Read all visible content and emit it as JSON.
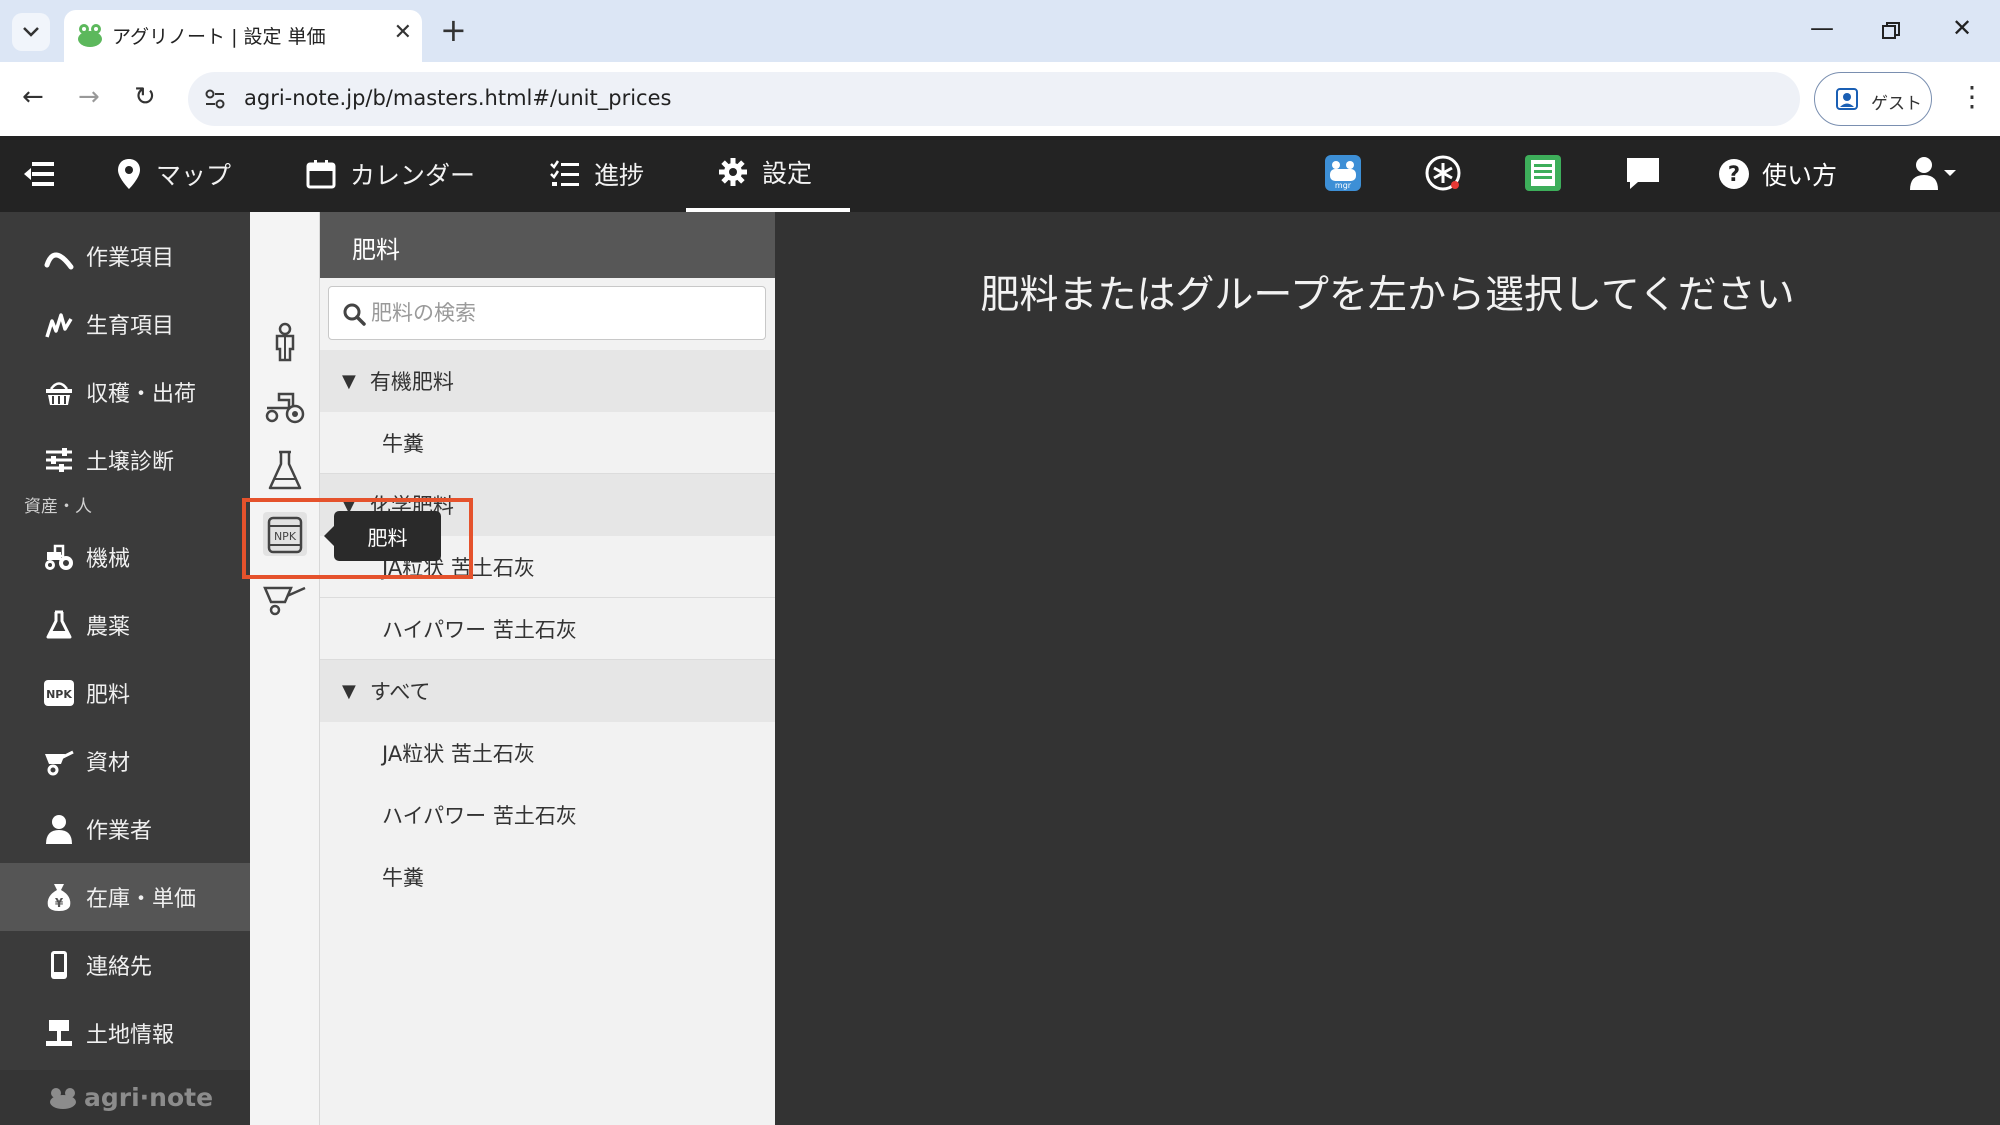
{
  "browser": {
    "tab_title": "アグリノート | 設定 単価",
    "url": "agri-note.jp/b/masters.html#/unit_prices",
    "profile_label": "ゲスト"
  },
  "header": {
    "nav": [
      {
        "label": "マップ",
        "icon": "map-pin-icon"
      },
      {
        "label": "カレンダー",
        "icon": "calendar-icon"
      },
      {
        "label": "進捗",
        "icon": "checklist-icon"
      },
      {
        "label": "設定",
        "icon": "gear-icon",
        "active": true
      }
    ],
    "right_icons": [
      "mgr-app-icon",
      "help-circle-icon",
      "green-book-icon",
      "chat-icon"
    ],
    "help_label": "使い方"
  },
  "sidebar": {
    "items_top": [
      {
        "label": "作業項目",
        "icon": "hoe-icon"
      },
      {
        "label": "生育項目",
        "icon": "growth-icon"
      },
      {
        "label": "収穫・出荷",
        "icon": "basket-icon"
      },
      {
        "label": "土壌診断",
        "icon": "sliders-icon"
      }
    ],
    "section_label": "資産・人",
    "items_assets": [
      {
        "label": "機械",
        "icon": "tractor-icon"
      },
      {
        "label": "農薬",
        "icon": "flask-icon"
      },
      {
        "label": "肥料",
        "icon": "npk-icon"
      },
      {
        "label": "資材",
        "icon": "wheelbarrow-icon"
      },
      {
        "label": "作業者",
        "icon": "person-icon"
      },
      {
        "label": "在庫・単価",
        "icon": "money-bag-icon",
        "active": true
      },
      {
        "label": "連絡先",
        "icon": "phone-icon"
      },
      {
        "label": "土地情報",
        "icon": "land-icon"
      }
    ],
    "logo_text": "agri·note"
  },
  "icon_strip": {
    "icons": [
      "worker-icon",
      "tractor-icon",
      "flask-icon",
      "npk-icon",
      "wheelbarrow-icon"
    ],
    "tooltip": "肥料"
  },
  "list_panel": {
    "title": "肥料",
    "search_placeholder": "肥料の検索",
    "groups": [
      {
        "name": "有機肥料",
        "items": [
          "牛糞"
        ]
      },
      {
        "name": "化学肥料",
        "items": [
          "JA粒状 苦土石灰",
          "ハイパワー 苦土石灰"
        ]
      },
      {
        "name": "すべて",
        "items": [
          "JA粒状 苦土石灰",
          "ハイパワー 苦土石灰",
          "牛糞"
        ]
      }
    ]
  },
  "main": {
    "message": "肥料またはグループを左から選択してください"
  }
}
